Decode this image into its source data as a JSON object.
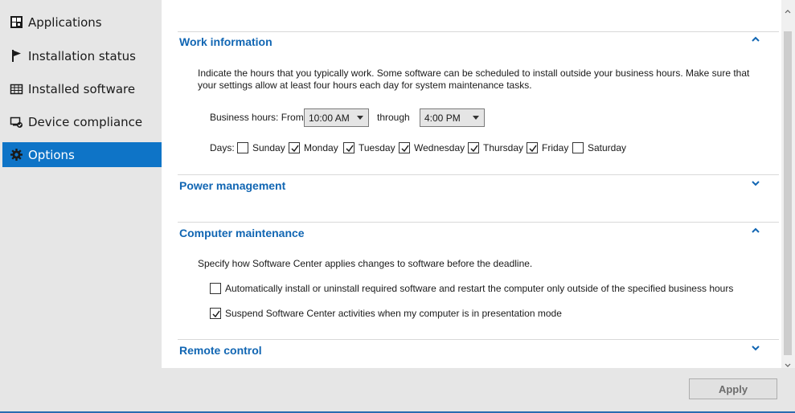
{
  "sidebar": {
    "items": [
      {
        "label": "Applications",
        "icon": "applications-grid-icon",
        "active": false
      },
      {
        "label": "Installation status",
        "icon": "flag-icon",
        "active": false
      },
      {
        "label": "Installed software",
        "icon": "table-icon",
        "active": false
      },
      {
        "label": "Device compliance",
        "icon": "device-check-icon",
        "active": false
      },
      {
        "label": "Options",
        "icon": "gear-icon",
        "active": true
      }
    ]
  },
  "work_information": {
    "title": "Work information",
    "description_line1": "Indicate the hours that you typically work. Some software can be scheduled to install outside your business hours. Make sure that",
    "description_line2": "your settings allow at least four hours each day for system maintenance tasks.",
    "business_hours_label": "Business hours: From",
    "from_value": "10:00 AM",
    "through_label": "through",
    "through_value": "4:00 PM",
    "days_label": "Days:",
    "days": [
      {
        "label": "Sunday",
        "checked": false
      },
      {
        "label": "Monday",
        "checked": true
      },
      {
        "label": "Tuesday",
        "checked": true
      },
      {
        "label": "Wednesday",
        "checked": true
      },
      {
        "label": "Thursday",
        "checked": true
      },
      {
        "label": "Friday",
        "checked": true
      },
      {
        "label": "Saturday",
        "checked": false
      }
    ]
  },
  "power_management": {
    "title": "Power management"
  },
  "computer_maintenance": {
    "title": "Computer maintenance",
    "description": "Specify how Software Center applies changes to software before the deadline.",
    "option1_label": "Automatically install or uninstall required software and restart the computer only outside of the specified business hours",
    "option1_checked": false,
    "option2_label": "Suspend Software Center activities when my computer is in presentation mode",
    "option2_checked": true
  },
  "remote_control": {
    "title": "Remote control"
  },
  "footer": {
    "apply_label": "Apply"
  },
  "colors": {
    "accent": "#0e74c7",
    "section_title": "#1166b3",
    "sidebar_bg": "#e6e6e6"
  }
}
